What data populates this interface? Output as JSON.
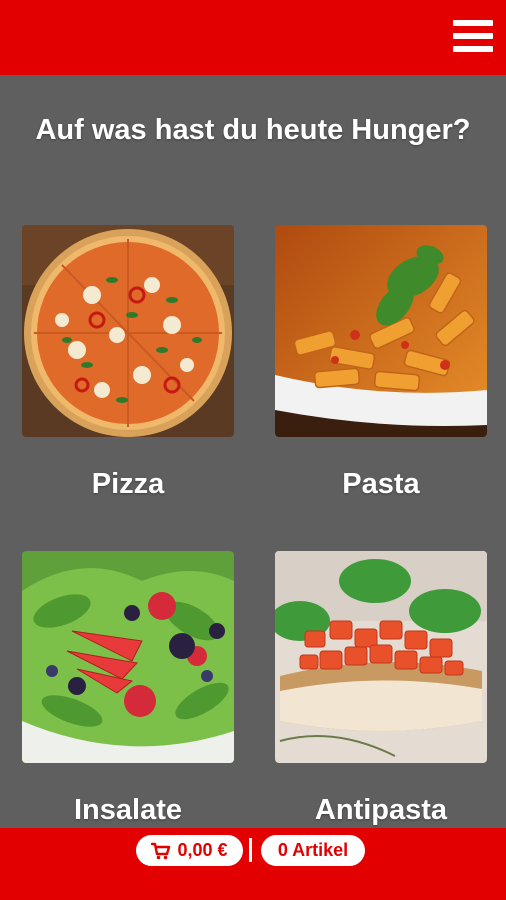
{
  "header": {
    "menu_icon": "hamburger-menu-icon",
    "accent_color": "#e30000"
  },
  "main": {
    "headline": "Auf was hast du heute Hunger?",
    "categories": [
      {
        "label": "Pizza",
        "image": "pizza-photo"
      },
      {
        "label": "Pasta",
        "image": "pasta-photo"
      },
      {
        "label": "Insalate",
        "image": "salad-photo"
      },
      {
        "label": "Antipasta",
        "image": "bruschetta-photo"
      }
    ]
  },
  "footer": {
    "cart_icon": "shopping-cart-icon",
    "cart_total": "0,00 €",
    "item_count": "0 Artikel"
  }
}
